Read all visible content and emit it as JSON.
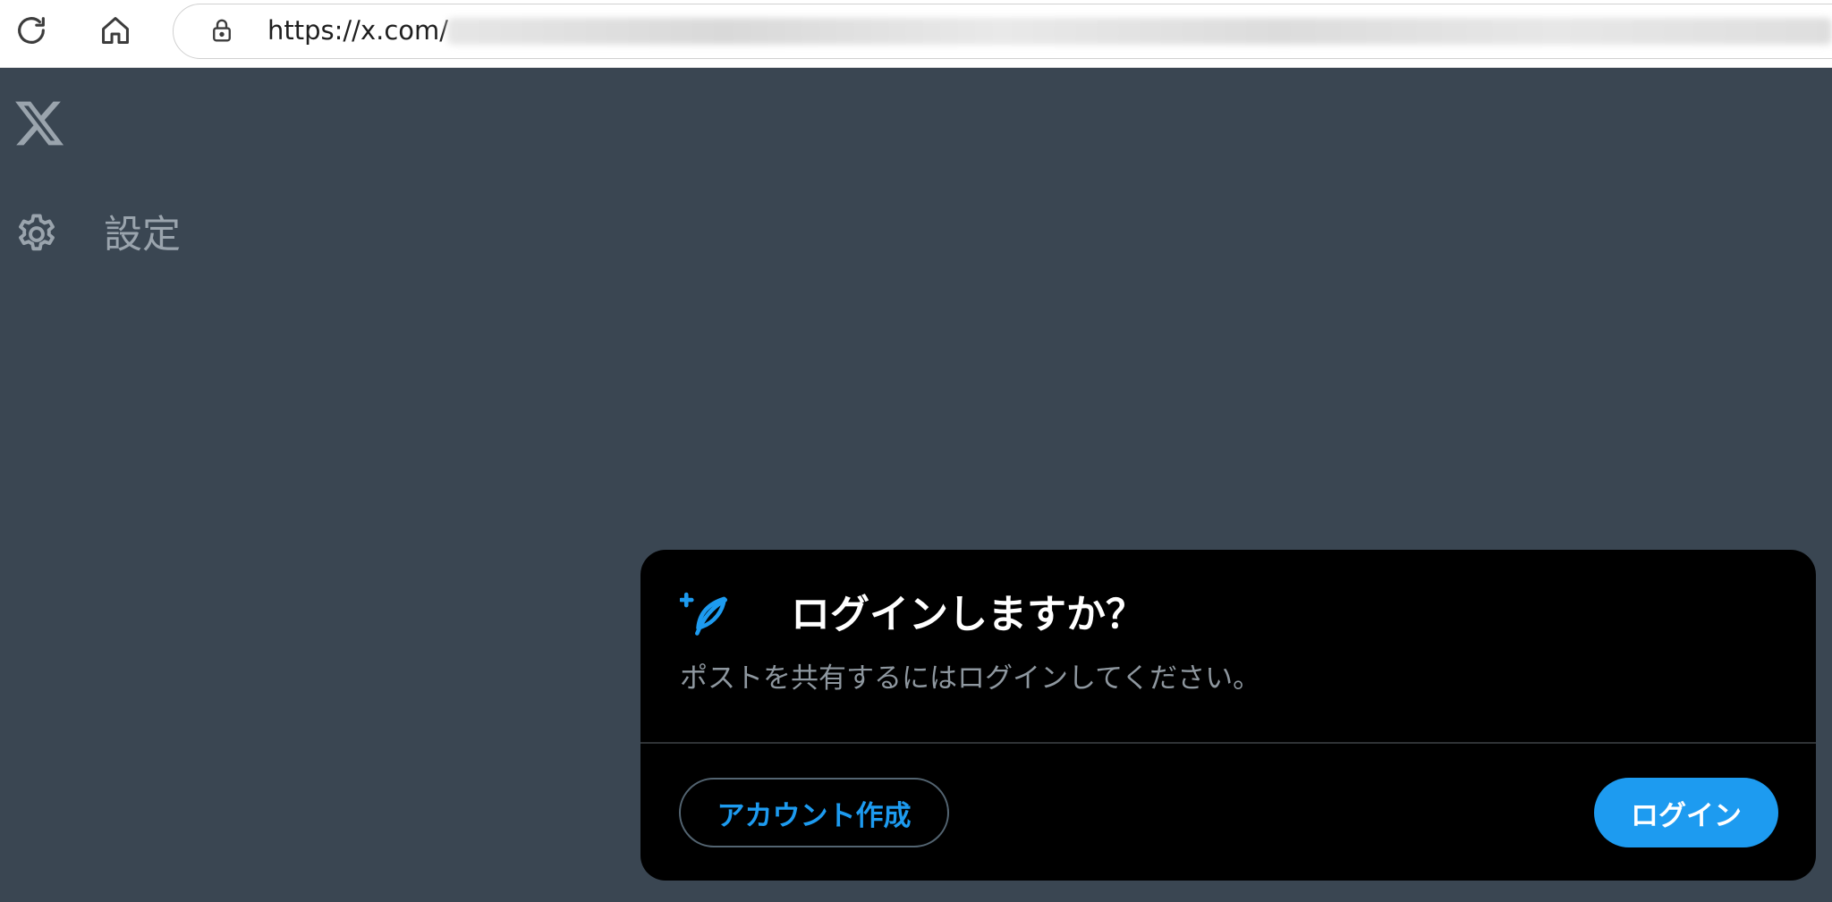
{
  "browser": {
    "url": "https://x.com/",
    "icons": {
      "reload": "reload-icon",
      "home": "home-icon",
      "lock": "lock-icon"
    }
  },
  "page": {
    "logo": "x-logo-icon",
    "settings_label": "設定",
    "settings_icon": "gear-icon"
  },
  "modal": {
    "icon": "quill-plus-icon",
    "title": "ログインしますか？",
    "subtitle": "ポストを共有するにはログインしてください。",
    "create_account_label": "アカウント作成",
    "login_label": "ログイン"
  },
  "colors": {
    "accent": "#1d9bf0",
    "page_bg": "#3a4652",
    "modal_bg": "#000000"
  }
}
